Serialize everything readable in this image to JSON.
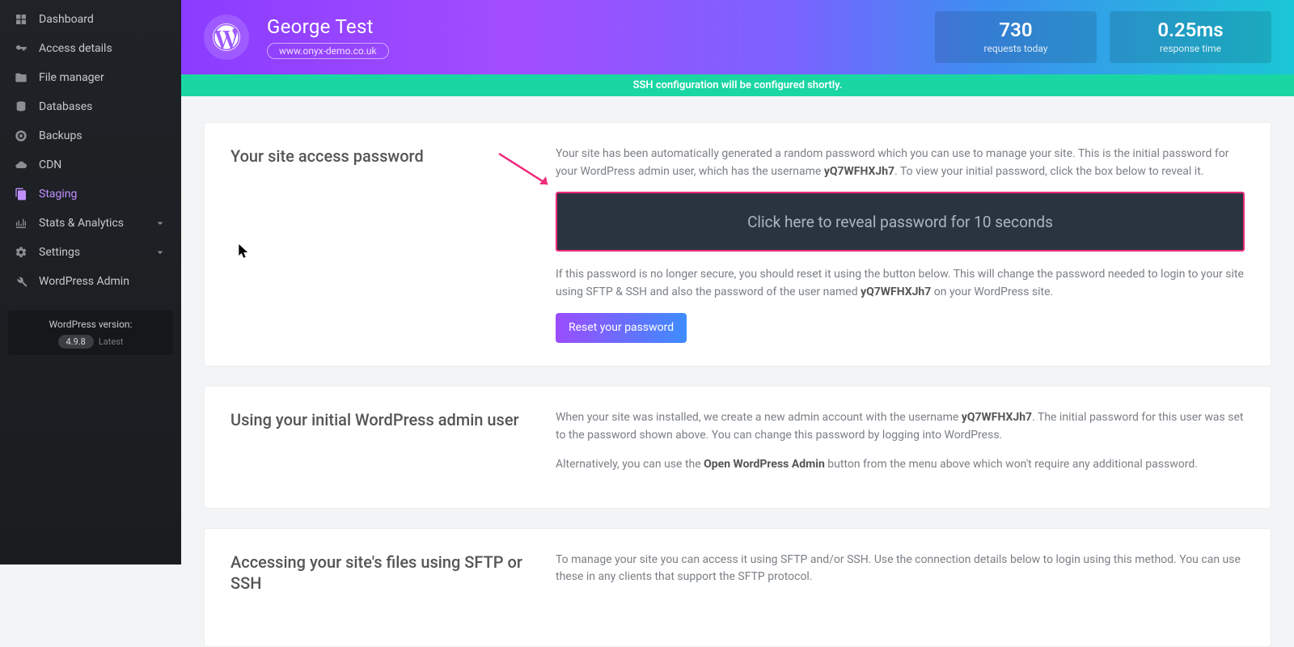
{
  "sidebar": {
    "items": [
      {
        "icon": "dashboard",
        "label": "Dashboard"
      },
      {
        "icon": "key",
        "label": "Access details"
      },
      {
        "icon": "folder",
        "label": "File manager"
      },
      {
        "icon": "db",
        "label": "Databases"
      },
      {
        "icon": "life",
        "label": "Backups"
      },
      {
        "icon": "cloud",
        "label": "CDN"
      },
      {
        "icon": "copy",
        "label": "Staging",
        "active": true
      },
      {
        "icon": "chart",
        "label": "Stats & Analytics",
        "expandable": true
      },
      {
        "icon": "gear",
        "label": "Settings",
        "expandable": true
      },
      {
        "icon": "wrench",
        "label": "WordPress Admin"
      }
    ],
    "wp_version_label": "WordPress version:",
    "wp_version": "4.9.8",
    "wp_latest": "Latest"
  },
  "hero": {
    "site_title": "George Test",
    "site_url": "www.onyx-demo.co.uk",
    "stats": [
      {
        "value": "730",
        "label": "requests today"
      },
      {
        "value": "0.25ms",
        "label": "response time"
      }
    ]
  },
  "banner": "SSH configuration will be configured shortly.",
  "password_section": {
    "heading": "Your site access password",
    "intro_a": "Your site has been automatically generated a random password which you can use to manage your site. This is the initial password for your WordPress admin user, which has the username ",
    "username": "yQ7WFHXJh7",
    "intro_b": ". To view your initial password, click the box below to reveal it.",
    "reveal_label": "Click here to reveal password for 10 seconds",
    "outro_a": "If this password is no longer secure, you should reset it using the button below. This will change the password needed to login to your site using SFTP & SSH and also the password of the user named ",
    "outro_b": " on your WordPress site.",
    "reset_button": "Reset your password"
  },
  "admin_section": {
    "heading": "Using your initial WordPress admin user",
    "p1a": "When your site was installed, we create a new admin account with the username ",
    "p1b": ". The initial password for this user was set to the password shown above. You can change this password by logging into WordPress.",
    "p2a": "Alternatively, you can use the ",
    "open_admin": "Open WordPress Admin",
    "p2b": " button from the menu above which won't require any additional password."
  },
  "sftp_section": {
    "heading": "Accessing your site's files using SFTP or SSH",
    "p1": "To manage your site you can access it using SFTP and/or SSH. Use the connection details below to login using this method. You can use these in any clients that support the SFTP protocol."
  }
}
